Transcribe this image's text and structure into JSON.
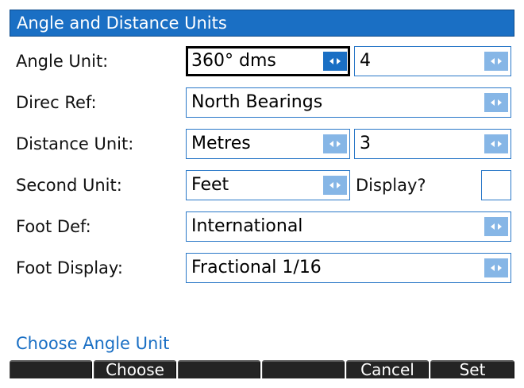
{
  "title": "Angle and Distance Units",
  "colors": {
    "accent": "#1a6fc4",
    "selector_button": "#86b6e6",
    "softkey_bg": "#242424"
  },
  "icons": {
    "selector": "left-right-arrows-icon"
  },
  "fields": {
    "angle_unit": {
      "label": "Angle Unit:",
      "value": "360° dms",
      "precision": "4"
    },
    "direc_ref": {
      "label": "Direc Ref:",
      "value": "North Bearings"
    },
    "distance_unit": {
      "label": "Distance Unit:",
      "value": "Metres",
      "precision": "3"
    },
    "second_unit": {
      "label": "Second Unit:",
      "value": "Feet",
      "display_label": "Display?",
      "display_checked": false
    },
    "foot_def": {
      "label": "Foot Def:",
      "value": "International"
    },
    "foot_display": {
      "label": "Foot Display:",
      "value": "Fractional 1/16"
    }
  },
  "help_text": "Choose Angle Unit",
  "softkeys": [
    "",
    "Choose",
    "",
    "",
    "Cancel",
    "Set"
  ]
}
